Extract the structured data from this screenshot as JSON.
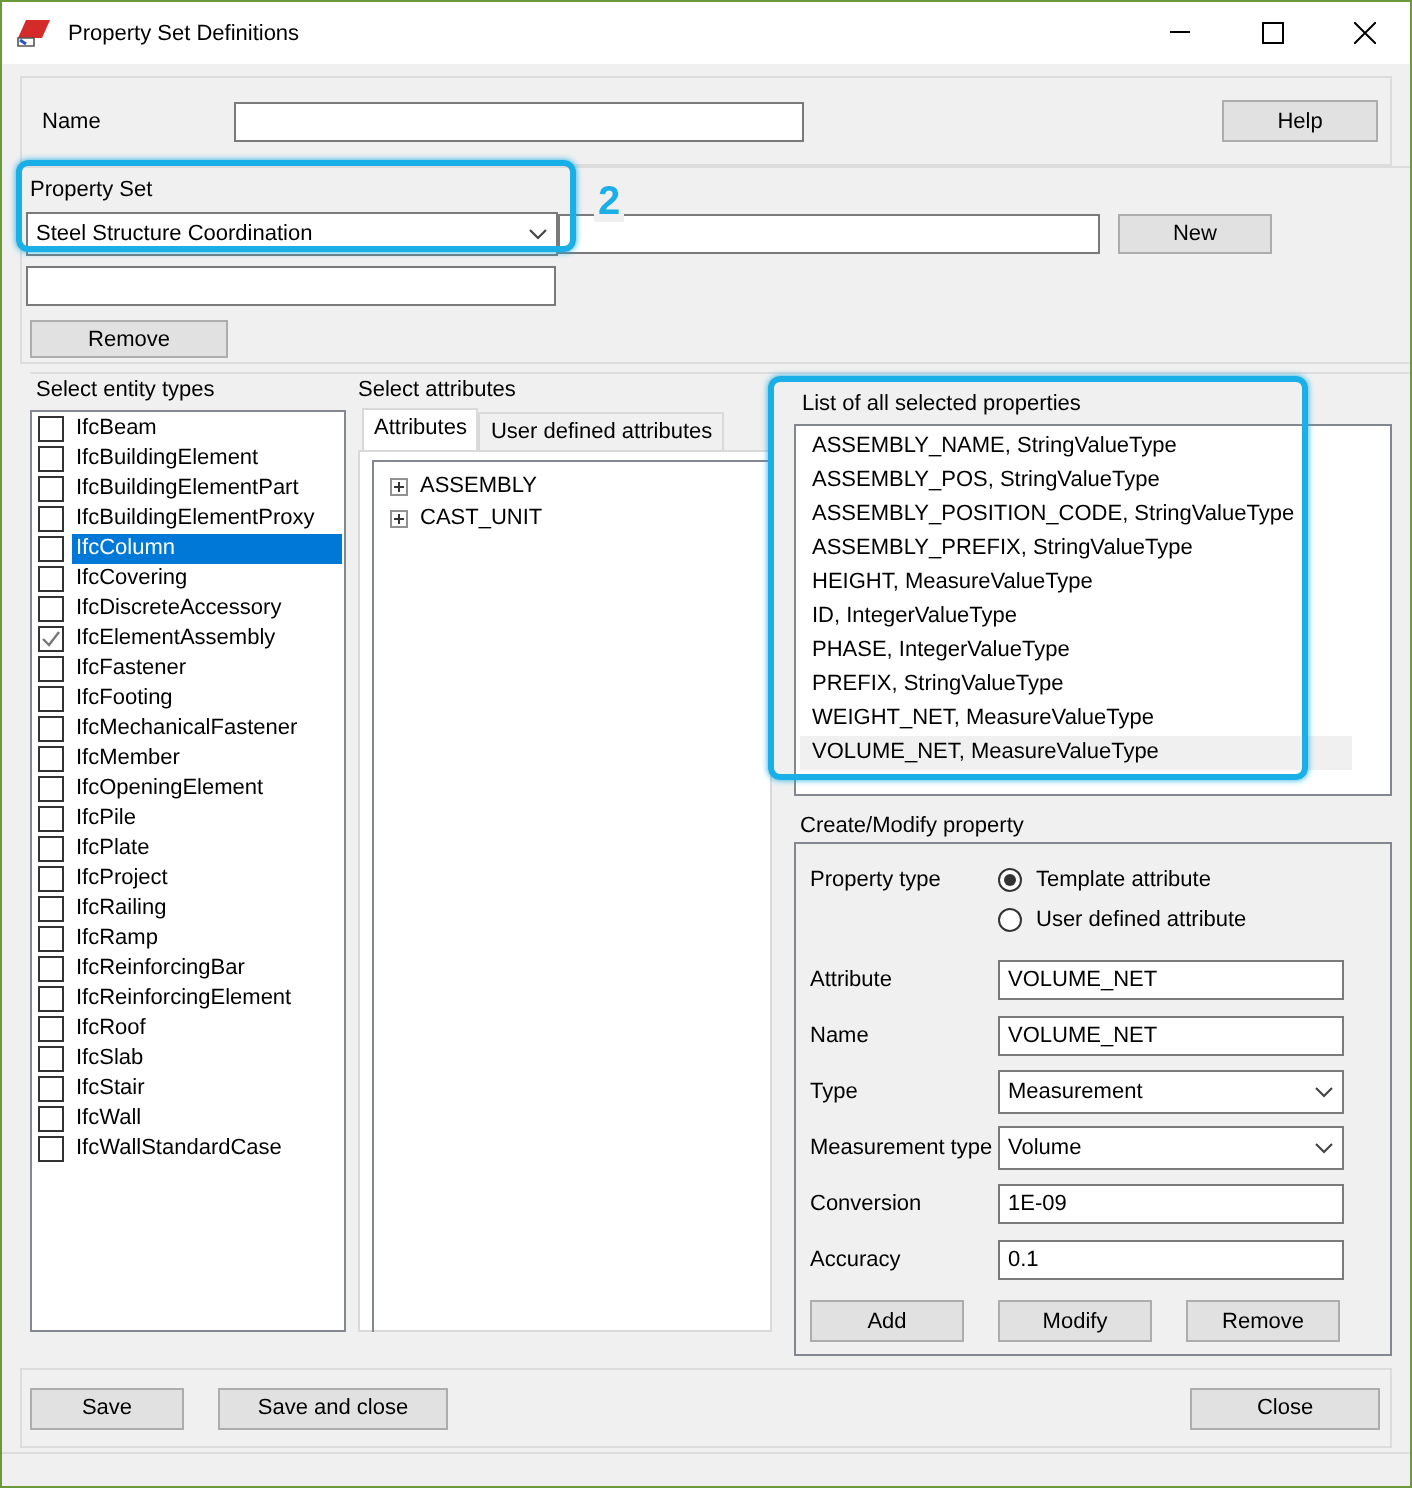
{
  "window": {
    "title": "Property Set Definitions"
  },
  "name": {
    "label": "Name",
    "help_button": "Help"
  },
  "property_set": {
    "label": "Property Set",
    "selected_value": "Steel Structure Coordination",
    "new_button": "New",
    "remove_button": "Remove",
    "callout": "2"
  },
  "entity_types": {
    "label": "Select entity types",
    "items": [
      {
        "label": "IfcBeam",
        "checked": false,
        "selected": false
      },
      {
        "label": "IfcBuildingElement",
        "checked": false,
        "selected": false
      },
      {
        "label": "IfcBuildingElementPart",
        "checked": false,
        "selected": false
      },
      {
        "label": "IfcBuildingElementProxy",
        "checked": false,
        "selected": false
      },
      {
        "label": "IfcColumn",
        "checked": false,
        "selected": true
      },
      {
        "label": "IfcCovering",
        "checked": false,
        "selected": false
      },
      {
        "label": "IfcDiscreteAccessory",
        "checked": false,
        "selected": false
      },
      {
        "label": "IfcElementAssembly",
        "checked": true,
        "selected": false
      },
      {
        "label": "IfcFastener",
        "checked": false,
        "selected": false
      },
      {
        "label": "IfcFooting",
        "checked": false,
        "selected": false
      },
      {
        "label": "IfcMechanicalFastener",
        "checked": false,
        "selected": false
      },
      {
        "label": "IfcMember",
        "checked": false,
        "selected": false
      },
      {
        "label": "IfcOpeningElement",
        "checked": false,
        "selected": false
      },
      {
        "label": "IfcPile",
        "checked": false,
        "selected": false
      },
      {
        "label": "IfcPlate",
        "checked": false,
        "selected": false
      },
      {
        "label": "IfcProject",
        "checked": false,
        "selected": false
      },
      {
        "label": "IfcRailing",
        "checked": false,
        "selected": false
      },
      {
        "label": "IfcRamp",
        "checked": false,
        "selected": false
      },
      {
        "label": "IfcReinforcingBar",
        "checked": false,
        "selected": false
      },
      {
        "label": "IfcReinforcingElement",
        "checked": false,
        "selected": false
      },
      {
        "label": "IfcRoof",
        "checked": false,
        "selected": false
      },
      {
        "label": "IfcSlab",
        "checked": false,
        "selected": false
      },
      {
        "label": "IfcStair",
        "checked": false,
        "selected": false
      },
      {
        "label": "IfcWall",
        "checked": false,
        "selected": false
      },
      {
        "label": "IfcWallStandardCase",
        "checked": false,
        "selected": false
      }
    ]
  },
  "attributes": {
    "label": "Select attributes",
    "tabs": [
      {
        "label": "Attributes",
        "selected": true
      },
      {
        "label": "User defined attributes",
        "selected": false
      }
    ],
    "tree": [
      {
        "label": "ASSEMBLY",
        "expanded": false
      },
      {
        "label": "CAST_UNIT",
        "expanded": false
      }
    ]
  },
  "selected_properties": {
    "label": "List of all selected properties",
    "items": [
      {
        "text": "ASSEMBLY_NAME,  StringValueType",
        "selected": false
      },
      {
        "text": "ASSEMBLY_POS,  StringValueType",
        "selected": false
      },
      {
        "text": "ASSEMBLY_POSITION_CODE,  StringValueType",
        "selected": false
      },
      {
        "text": "ASSEMBLY_PREFIX,  StringValueType",
        "selected": false
      },
      {
        "text": "HEIGHT,  MeasureValueType",
        "selected": false
      },
      {
        "text": "ID,  IntegerValueType",
        "selected": false
      },
      {
        "text": "PHASE,  IntegerValueType",
        "selected": false
      },
      {
        "text": "PREFIX,  StringValueType",
        "selected": false
      },
      {
        "text": "WEIGHT_NET,  MeasureValueType",
        "selected": false
      },
      {
        "text": "VOLUME_NET,  MeasureValueType",
        "selected": true
      }
    ]
  },
  "create_modify": {
    "label": "Create/Modify property",
    "property_type": {
      "label": "Property type",
      "options": [
        {
          "label": "Template attribute",
          "selected": true
        },
        {
          "label": "User defined attribute",
          "selected": false
        }
      ]
    },
    "fields": [
      {
        "kind": "text",
        "label": "Attribute",
        "value": "VOLUME_NET"
      },
      {
        "kind": "text",
        "label": "Name",
        "value": "VOLUME_NET"
      },
      {
        "kind": "dropdown",
        "label": "Type",
        "value": "Measurement"
      },
      {
        "kind": "dropdown",
        "label": "Measurement type",
        "value": "Volume"
      },
      {
        "kind": "text",
        "label": "Conversion",
        "value": "1E-09"
      },
      {
        "kind": "text",
        "label": "Accuracy",
        "value": "0.1"
      }
    ],
    "buttons": [
      "Add",
      "Modify",
      "Remove"
    ]
  },
  "footer": {
    "buttons": [
      "Save",
      "Save and close"
    ],
    "close_button": "Close"
  }
}
